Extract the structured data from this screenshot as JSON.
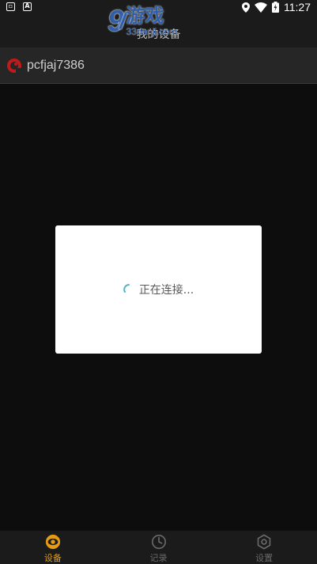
{
  "status_bar": {
    "left_icons": [
      "notification-icon",
      "app-a-icon"
    ],
    "right_icons": [
      "location-icon",
      "wifi-icon",
      "battery-icon"
    ],
    "time": "11:27"
  },
  "watermark": {
    "logo": "9",
    "cn_text": "游戏",
    "url": "33danji.com"
  },
  "app_bar": {
    "title": "我的设备"
  },
  "device": {
    "name": "pcfjaj7386",
    "icon": "camera-logo-icon"
  },
  "dialog": {
    "message": "正在连接..."
  },
  "bottom_nav": {
    "items": [
      {
        "label": "设备",
        "icon": "device-eye-icon",
        "active": true
      },
      {
        "label": "记录",
        "icon": "clock-icon",
        "active": false
      },
      {
        "label": "设置",
        "icon": "gear-icon",
        "active": false
      }
    ]
  },
  "colors": {
    "accent": "#e59b12",
    "dialog_bg": "#ffffff",
    "background": "#0d0d0d"
  }
}
